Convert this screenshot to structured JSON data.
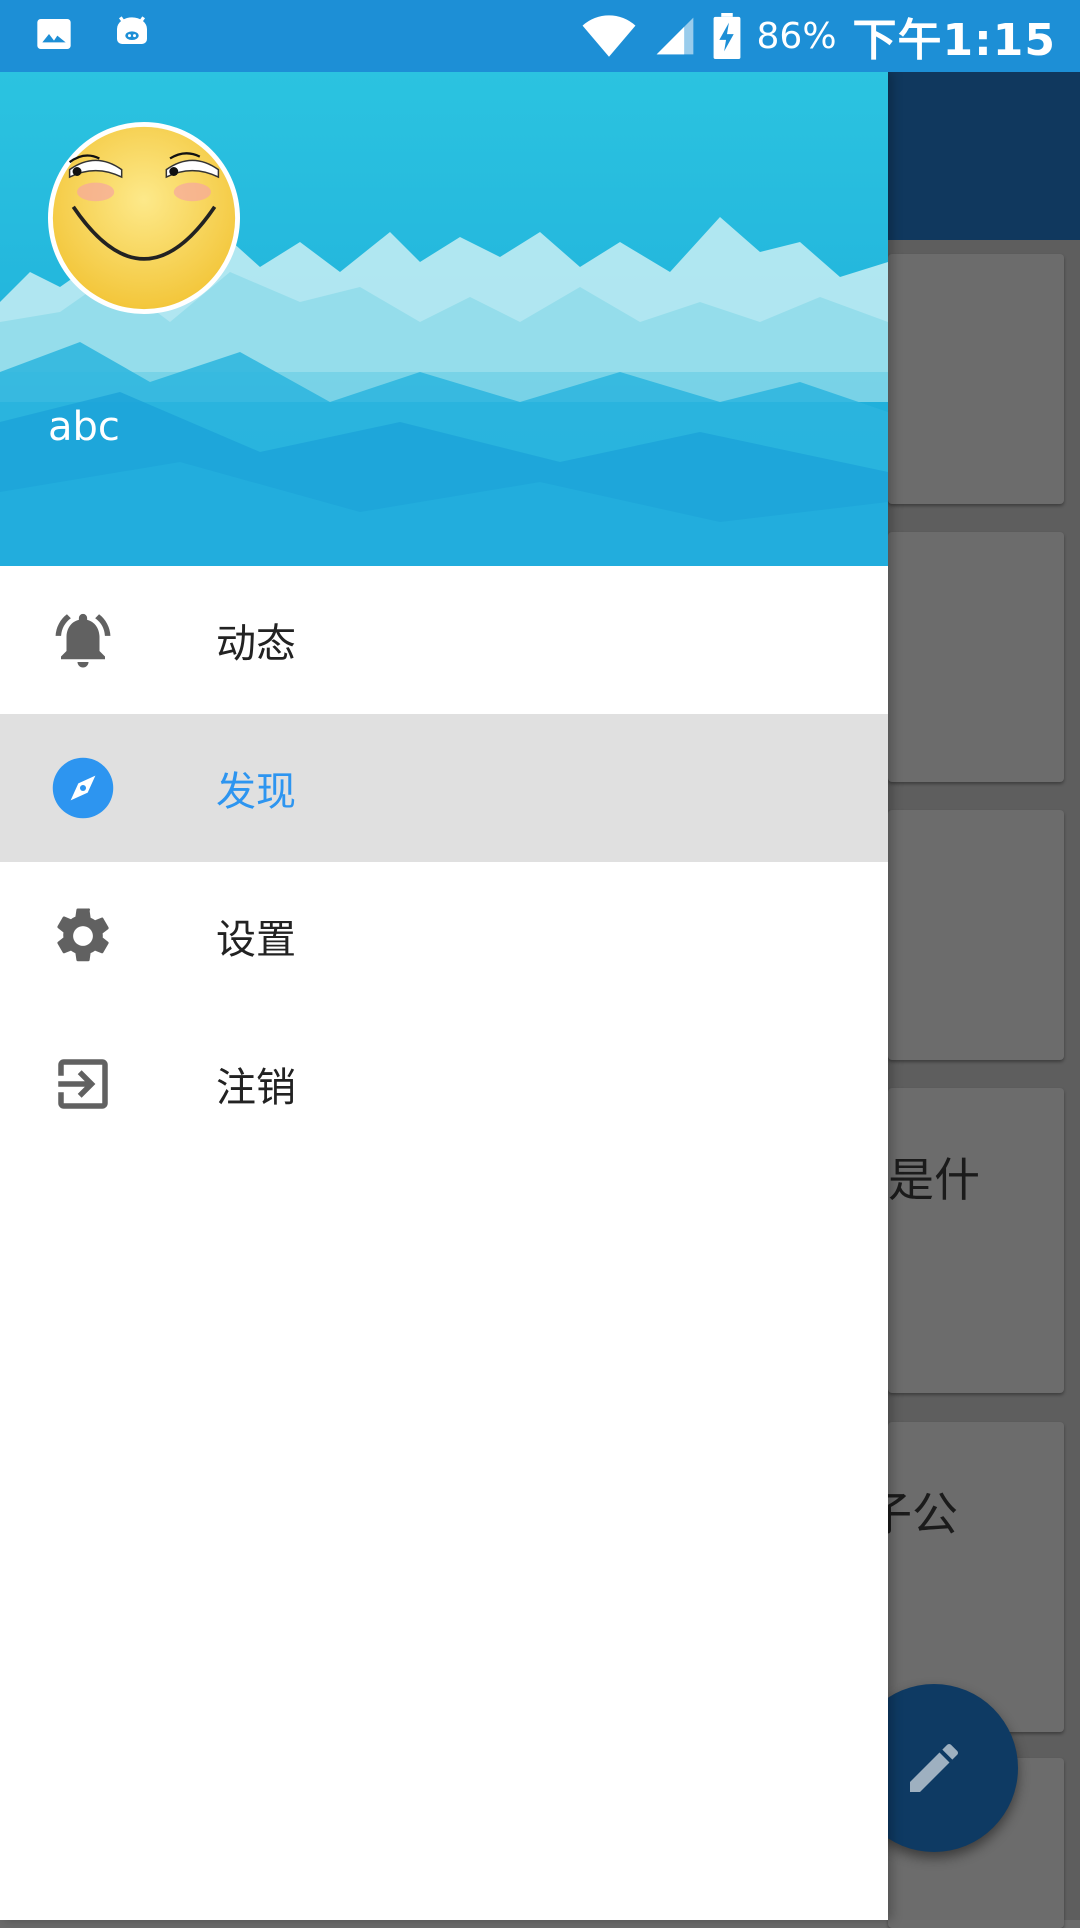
{
  "status_bar": {
    "battery_percent": "86%",
    "time": "下午1:15",
    "icons": [
      "image-icon",
      "android-debug-icon",
      "wifi-icon",
      "cell-signal-icon",
      "battery-charging-icon"
    ]
  },
  "drawer": {
    "header": {
      "username": "abc",
      "avatar_icon": "smiley-avatar"
    },
    "menu_items": [
      {
        "label": "动态",
        "icon": "bell-icon",
        "active": false
      },
      {
        "label": "发现",
        "icon": "compass-icon",
        "active": true
      },
      {
        "label": "设置",
        "icon": "gear-icon",
        "active": false
      },
      {
        "label": "注销",
        "icon": "exit-icon",
        "active": false
      }
    ]
  },
  "background_content": {
    "visible_card_fragments": [
      "是什",
      "子公"
    ],
    "fab_icon": "pencil-icon"
  },
  "colors": {
    "status_bar": "#1d8fd6",
    "app_bar": "#10385e",
    "accent": "#2d95f0",
    "active_item_bg": "#e0e0e0",
    "icon_gray": "#616161"
  }
}
